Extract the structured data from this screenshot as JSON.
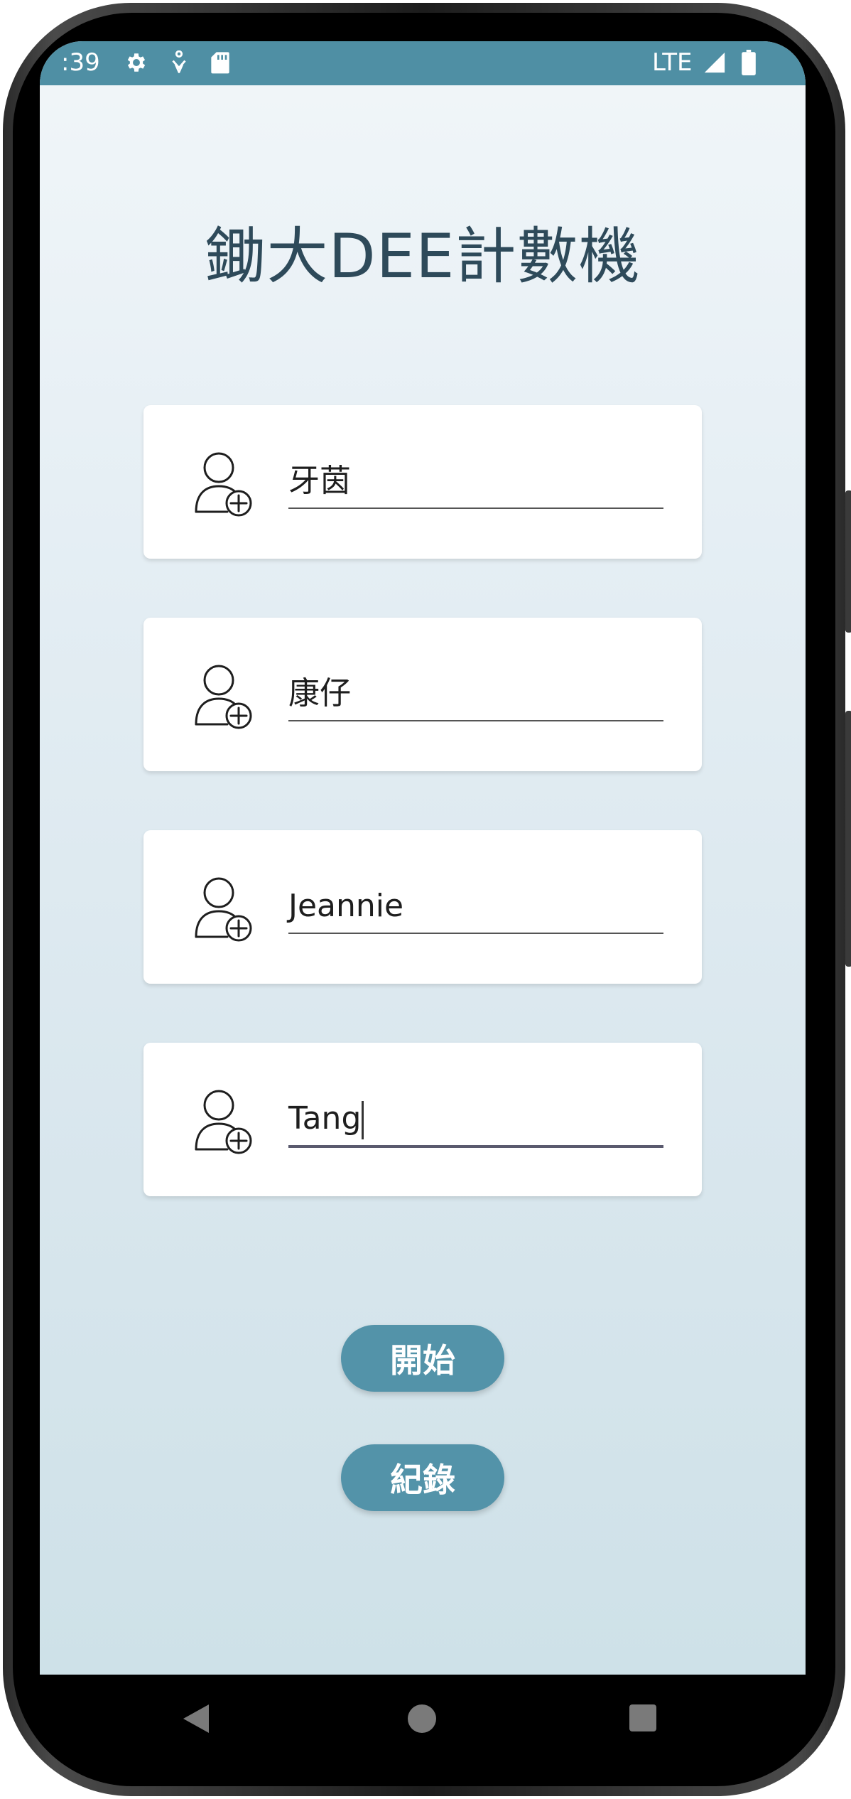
{
  "status_bar": {
    "time": ":39",
    "network": "LTE",
    "icons": [
      "settings-icon",
      "accessibility-icon",
      "sd-card-icon",
      "signal-icon",
      "battery-icon"
    ],
    "color": "#4f8fa4"
  },
  "app": {
    "title": "鋤大DEE計數機"
  },
  "players": [
    {
      "name": "牙茵",
      "icon": "add-person-icon"
    },
    {
      "name": "康仔",
      "icon": "add-person-icon"
    },
    {
      "name": "Jeannie",
      "icon": "add-person-icon"
    },
    {
      "name": "Tang",
      "icon": "add-person-icon",
      "focused": true
    }
  ],
  "buttons": {
    "start_label": "開始",
    "records_label": "紀錄",
    "color": "#5393a9"
  },
  "nav_bar": {
    "icons": [
      "back-icon",
      "home-icon",
      "recents-icon"
    ]
  }
}
